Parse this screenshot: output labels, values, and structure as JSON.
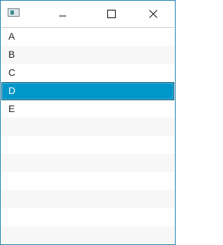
{
  "window": {
    "icon": "app-window-icon",
    "controls": [
      "minimize-icon",
      "maximize-icon",
      "close-icon"
    ]
  },
  "list": {
    "items": [
      "A",
      "B",
      "C",
      "D",
      "E"
    ],
    "selected_index": 3,
    "selected_color": "#0096c9"
  }
}
